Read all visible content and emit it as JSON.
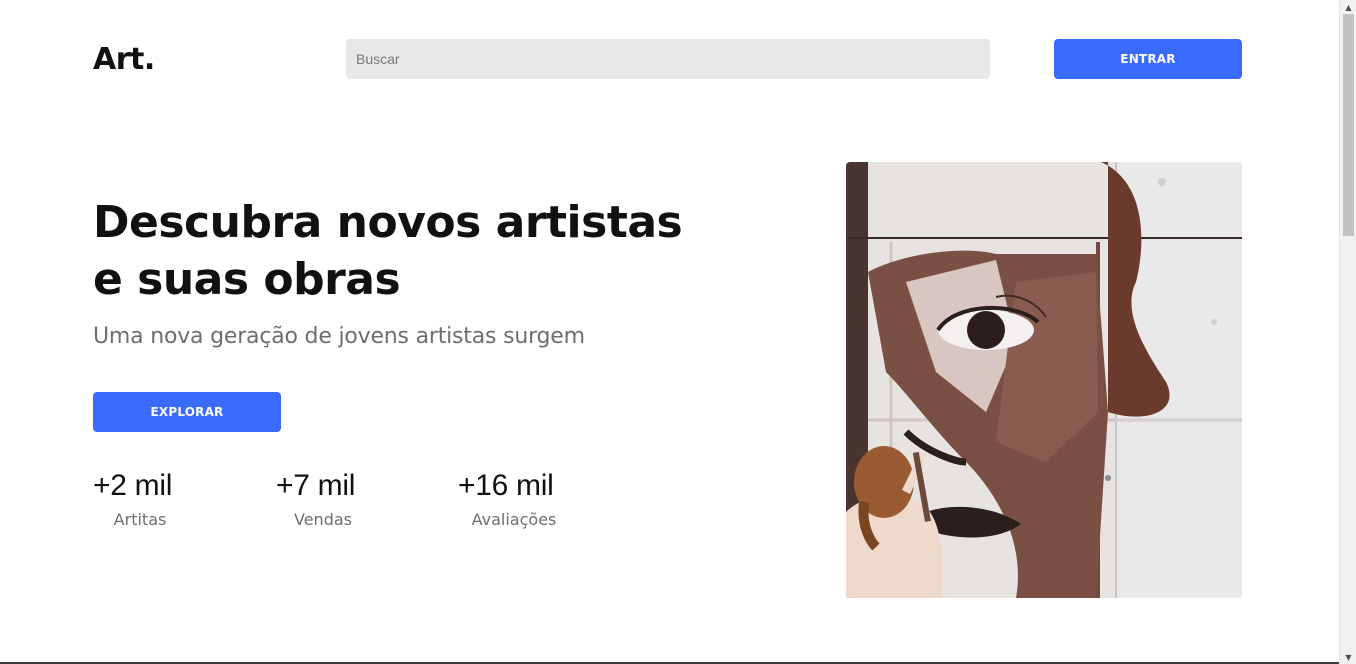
{
  "header": {
    "logo": "Art.",
    "search_placeholder": "Buscar",
    "login_label": "ENTRAR"
  },
  "hero": {
    "title_line1": "Descubra novos artistas",
    "title_line2": "e suas obras",
    "subtitle": "Uma nova geração de jovens artistas surgem",
    "explore_label": "EXPLORAR",
    "image_icon": "mural-painting-photo"
  },
  "stats": [
    {
      "value": "+2 mil",
      "label": "Artitas"
    },
    {
      "value": "+7 mil",
      "label": "Vendas"
    },
    {
      "value": "+16 mil",
      "label": "Avaliações"
    }
  ],
  "colors": {
    "accent": "#3a6bfb",
    "search_bg": "#e8e8e8",
    "muted_text": "#6e6e6e"
  },
  "scrollbar": {
    "up_arrow": "▲",
    "down_arrow": "▼"
  }
}
